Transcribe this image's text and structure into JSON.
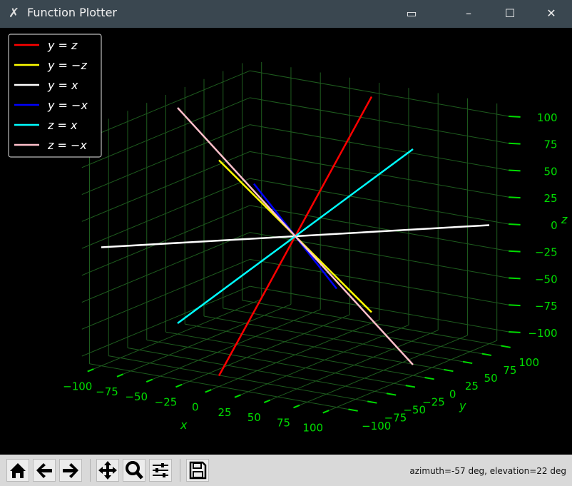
{
  "window": {
    "title": "Function Plotter",
    "controls": [
      "restore",
      "minimize",
      "maximize",
      "close"
    ]
  },
  "toolbar": {
    "buttons": [
      {
        "name": "home",
        "icon": "home-icon"
      },
      {
        "name": "back",
        "icon": "arrow-left-icon"
      },
      {
        "name": "forward",
        "icon": "arrow-right-icon"
      },
      {
        "name": "pan",
        "icon": "move-icon"
      },
      {
        "name": "zoom",
        "icon": "magnifier-icon"
      },
      {
        "name": "configure-subplots",
        "icon": "sliders-icon"
      },
      {
        "name": "save",
        "icon": "floppy-disk-icon"
      }
    ],
    "status": "azimuth=-57 deg, elevation=22 deg"
  },
  "chart_data": {
    "type": "line3d",
    "background": "#000000",
    "grid": true,
    "grid_color": "#1e5c1e",
    "tick_color": "#00dd00",
    "xlabel": "x",
    "ylabel": "y",
    "zlabel": "z",
    "xticks": [
      -100,
      -75,
      -50,
      -25,
      0,
      25,
      50,
      75,
      100
    ],
    "yticks": [
      -100,
      -75,
      -50,
      -25,
      0,
      25,
      50,
      75,
      100
    ],
    "zticks": [
      -100,
      -75,
      -50,
      -25,
      0,
      25,
      50,
      75,
      100
    ],
    "tick_labels": [
      "−100",
      "−75",
      "−50",
      "−25",
      "0",
      "25",
      "50",
      "75",
      "100"
    ],
    "view": {
      "azimuth": -57,
      "elevation": 22
    },
    "legend_position": "top-left",
    "series": [
      {
        "name": "y = z",
        "color": "#ff0000",
        "x": [
          0,
          0
        ],
        "y": [
          -100,
          100
        ],
        "z": [
          -100,
          100
        ]
      },
      {
        "name": "y = −z",
        "color": "#ffff00",
        "x": [
          0,
          0
        ],
        "y": [
          -100,
          100
        ],
        "z": [
          100,
          -100
        ]
      },
      {
        "name": "y = x",
        "color": "#ffffff",
        "x": [
          -100,
          100
        ],
        "y": [
          -100,
          100
        ],
        "z": [
          0,
          0
        ]
      },
      {
        "name": "y = −x",
        "color": "#0000ff",
        "x": [
          -100,
          100
        ],
        "y": [
          100,
          -100
        ],
        "z": [
          0,
          0
        ]
      },
      {
        "name": "z = x",
        "color": "#00ffff",
        "x": [
          -100,
          100
        ],
        "y": [
          0,
          0
        ],
        "z": [
          -100,
          100
        ]
      },
      {
        "name": "z = −x",
        "color": "#ffc0cb",
        "x": [
          -100,
          100
        ],
        "y": [
          0,
          0
        ],
        "z": [
          100,
          -100
        ]
      }
    ]
  }
}
